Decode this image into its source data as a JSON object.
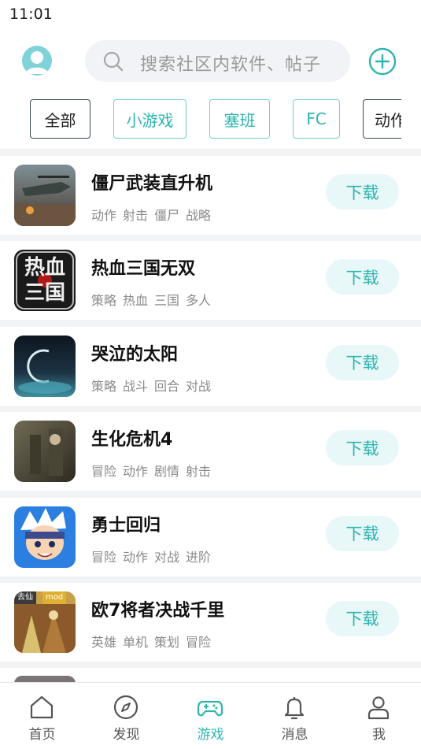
{
  "status_bar": {
    "time": "11:01"
  },
  "header": {
    "search_placeholder": "搜索社区内软件、帖子"
  },
  "categories": [
    "全部",
    "小游戏",
    "塞班",
    "FC",
    "动作"
  ],
  "games": [
    {
      "title": "僵尸武装直升机",
      "tags": [
        "动作",
        "射击",
        "僵尸",
        "战略"
      ],
      "button": "下载"
    },
    {
      "title": "热血三国无双",
      "tags": [
        "策略",
        "热血",
        "三国",
        "多人"
      ],
      "button": "下载",
      "icon_text": "热血三国"
    },
    {
      "title": "哭泣的太阳",
      "tags": [
        "策略",
        "战斗",
        "回合",
        "对战"
      ],
      "button": "下载"
    },
    {
      "title": "生化危机4",
      "tags": [
        "冒险",
        "动作",
        "剧情",
        "射击"
      ],
      "button": "下载"
    },
    {
      "title": "勇士回归",
      "tags": [
        "冒险",
        "动作",
        "对战",
        "进阶"
      ],
      "button": "下载"
    },
    {
      "title": "欧7将者决战千里",
      "tags": [
        "英雄",
        "单机",
        "策划",
        "冒险"
      ],
      "button": "下载",
      "icon_badges": [
        "去仙",
        "mod"
      ]
    }
  ],
  "bottom_nav": [
    {
      "label": "首页",
      "icon": "home-icon"
    },
    {
      "label": "发现",
      "icon": "compass-icon"
    },
    {
      "label": "游戏",
      "icon": "gamepad-icon",
      "active": true
    },
    {
      "label": "消息",
      "icon": "bell-icon"
    },
    {
      "label": "我",
      "icon": "user-icon"
    }
  ],
  "colors": {
    "accent": "#2cb4ae",
    "accent_light": "#e8f7f8",
    "divider": "#f2f3f5"
  }
}
